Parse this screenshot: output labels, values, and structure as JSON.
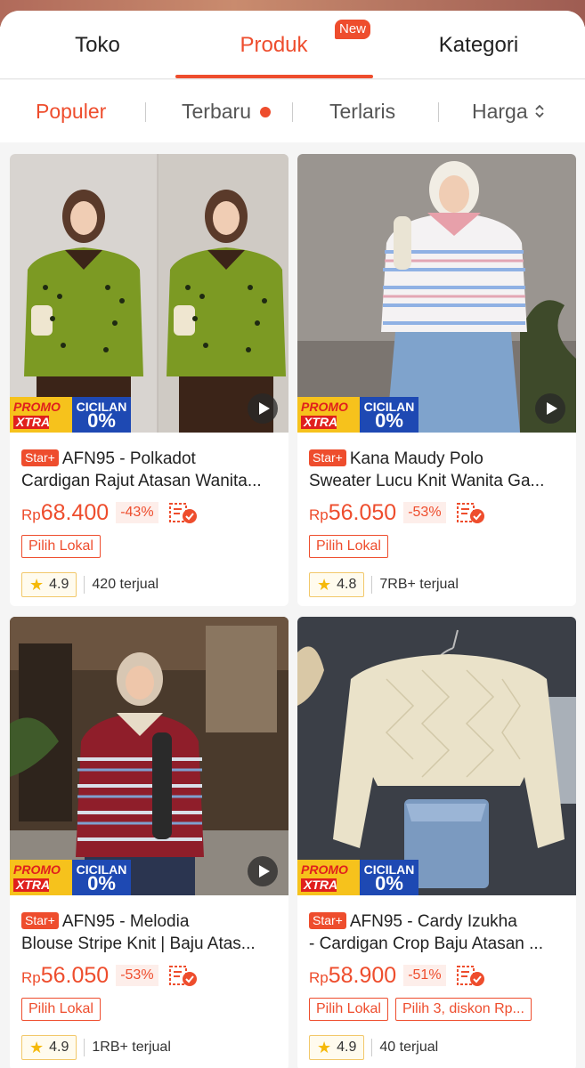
{
  "tabs": {
    "toko": "Toko",
    "produk": "Produk",
    "kategori": "Kategori",
    "new_badge": "New"
  },
  "sort": {
    "populer": "Populer",
    "terbaru": "Terbaru",
    "terlaris": "Terlaris",
    "harga": "Harga"
  },
  "colors": {
    "accent": "#ee4d2d",
    "promo_yellow": "#f6c21c",
    "promo_blue": "#1e49b3"
  },
  "promo": {
    "promo_label": "PROMO",
    "xtra_label": "XTRA",
    "cicilan_label": "CICILAN",
    "cicilan_value": "0%"
  },
  "products": [
    {
      "badge": "Star+",
      "title_line1": "AFN95 - Polkadot",
      "title_line2": "Cardigan Rajut Atasan Wanita...",
      "currency": "Rp",
      "price": "68.400",
      "discount": "-43%",
      "tags": [
        "Pilih Lokal"
      ],
      "rating": "4.9",
      "sold": "420 terjual"
    },
    {
      "badge": "Star+",
      "title_line1": "Kana Maudy Polo",
      "title_line2": "Sweater Lucu Knit Wanita Ga...",
      "currency": "Rp",
      "price": "56.050",
      "discount": "-53%",
      "tags": [
        "Pilih Lokal"
      ],
      "rating": "4.8",
      "sold": "7RB+ terjual"
    },
    {
      "badge": "Star+",
      "title_line1": "AFN95 - Melodia",
      "title_line2": "Blouse Stripe Knit | Baju Atas...",
      "currency": "Rp",
      "price": "56.050",
      "discount": "-53%",
      "tags": [
        "Pilih Lokal"
      ],
      "rating": "4.9",
      "sold": "1RB+ terjual"
    },
    {
      "badge": "Star+",
      "title_line1": "AFN95 - Cardy Izukha",
      "title_line2": "- Cardigan Crop Baju Atasan ...",
      "currency": "Rp",
      "price": "58.900",
      "discount": "-51%",
      "tags": [
        "Pilih Lokal",
        "Pilih 3, diskon Rp..."
      ],
      "rating": "4.9",
      "sold": "40 terjual"
    }
  ]
}
